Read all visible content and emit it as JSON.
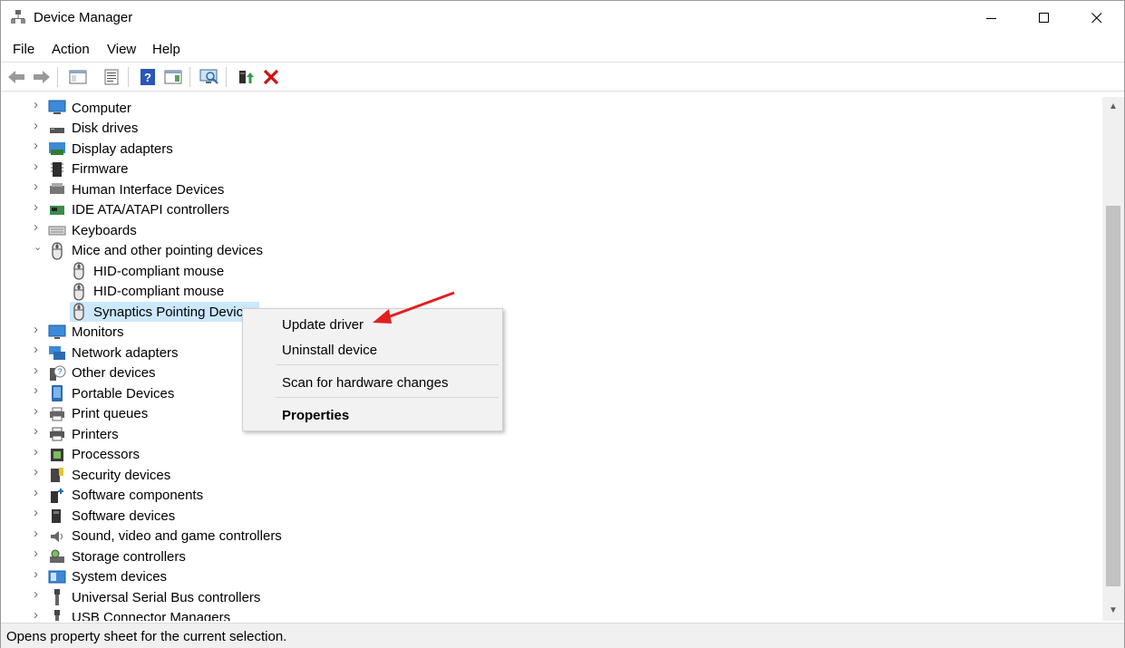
{
  "window": {
    "title": "Device Manager"
  },
  "menu": [
    "File",
    "Action",
    "View",
    "Help"
  ],
  "toolbar": {
    "buttons": [
      "back-icon",
      "forward-icon",
      "show-hide-console-tree-icon",
      "properties-icon",
      "help-icon",
      "action-pane-icon",
      "scan-hardware-icon",
      "update-driver-icon",
      "uninstall-icon"
    ]
  },
  "tree": {
    "categories": [
      "Computer",
      "Disk drives",
      "Display adapters",
      "Firmware",
      "Human Interface Devices",
      "IDE ATA/ATAPI controllers",
      "Keyboards",
      "Mice and other pointing devices",
      "Monitors",
      "Network adapters",
      "Other devices",
      "Portable Devices",
      "Print queues",
      "Printers",
      "Processors",
      "Security devices",
      "Software components",
      "Software devices",
      "Sound, video and game controllers",
      "Storage controllers",
      "System devices",
      "Universal Serial Bus controllers",
      "USB Connector Managers"
    ],
    "mice_children": [
      "HID-compliant mouse",
      "HID-compliant mouse",
      "Synaptics Pointing Device"
    ]
  },
  "context_menu": {
    "update_driver": "Update driver",
    "uninstall_device": "Uninstall device",
    "scan_hardware": "Scan for hardware changes",
    "properties": "Properties"
  },
  "status": {
    "text": "Opens property sheet for the current selection."
  },
  "colors": {
    "selection": "#cce8ff",
    "annotation_arrow": "#e02020",
    "delete_red": "#d01010"
  }
}
